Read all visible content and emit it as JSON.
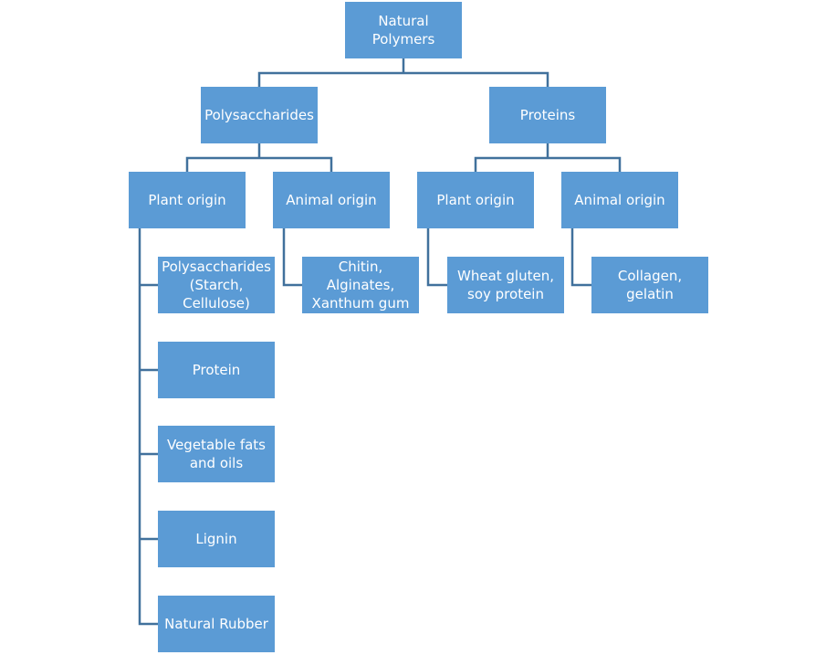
{
  "colors": {
    "node_fill": "#5b9bd5",
    "node_text": "#ffffff",
    "connector": "#41719c"
  },
  "root": {
    "label": "Natural\nPolymers"
  },
  "level1": [
    {
      "label": "Polysaccharides"
    },
    {
      "label": "Proteins"
    }
  ],
  "level2": [
    {
      "label": "Plant origin"
    },
    {
      "label": "Animal origin"
    },
    {
      "label": "Plant origin"
    },
    {
      "label": "Animal origin"
    }
  ],
  "leaves": {
    "poly_plant": [
      {
        "label": "Polysaccharides\n(Starch,\nCellulose)"
      },
      {
        "label": "Protein"
      },
      {
        "label": "Vegetable fats\nand oils"
      },
      {
        "label": "Lignin"
      },
      {
        "label": "Natural Rubber"
      }
    ],
    "poly_animal": {
      "label": "Chitin, Alginates,\nXanthum gum"
    },
    "protein_plant": {
      "label": "Wheat gluten,\nsoy protein"
    },
    "protein_animal": {
      "label": "Collagen, gelatin"
    }
  }
}
